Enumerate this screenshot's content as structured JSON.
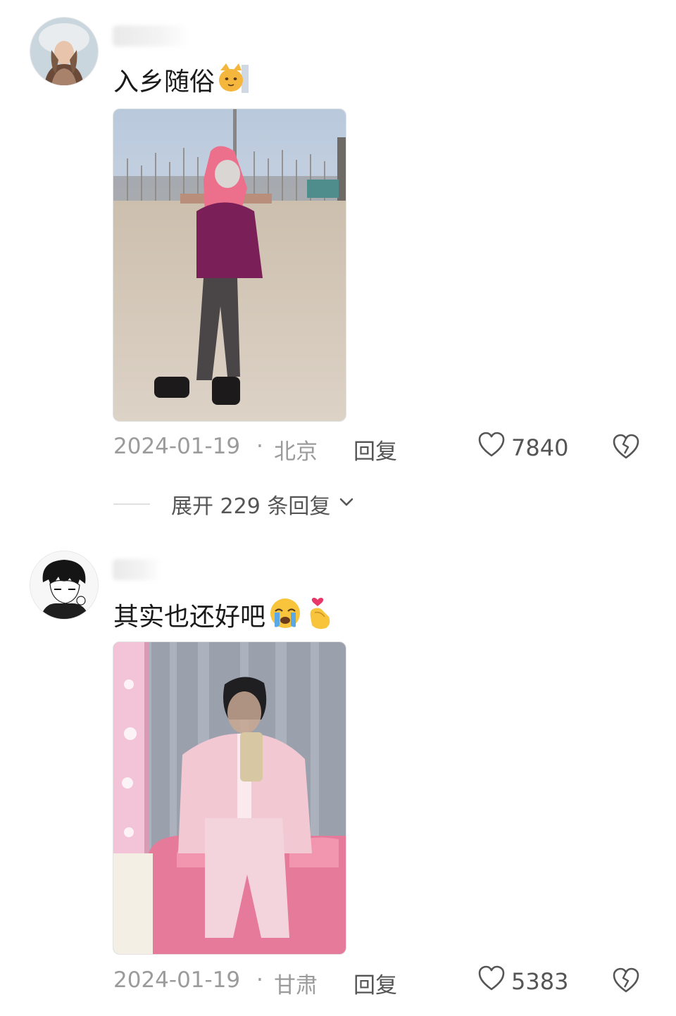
{
  "comments": [
    {
      "text": "入乡随俗",
      "date": "2024-01-19",
      "separator": "·",
      "location": "北京",
      "reply_label": "回复",
      "likes": "7840",
      "emoji": [
        "cat-face-icon"
      ],
      "expand_replies_label": "展开 229 条回复"
    },
    {
      "text": "其实也还好吧",
      "date": "2024-01-19",
      "separator": "·",
      "location": "甘肃",
      "reply_label": "回复",
      "likes": "5383",
      "emoji": [
        "crying-face-icon",
        "finger-heart-icon"
      ]
    }
  ],
  "colors": {
    "text_primary": "#1a1a1a",
    "text_meta": "#9b9b9b",
    "text_secondary": "#555555",
    "background": "#ffffff"
  }
}
